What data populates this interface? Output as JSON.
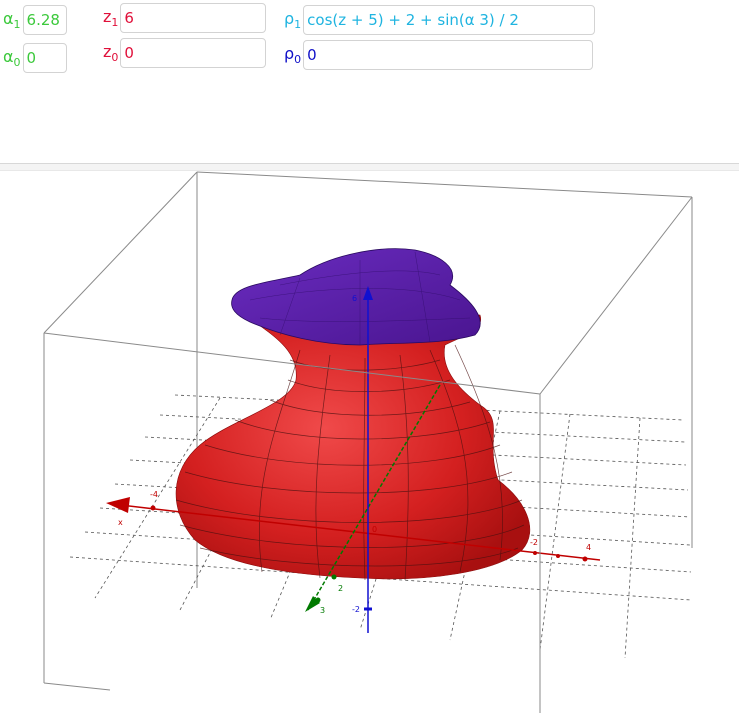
{
  "params": {
    "alpha1": {
      "symbol": "α",
      "sub": "1",
      "value": "6.28"
    },
    "alpha0": {
      "symbol": "α",
      "sub": "0",
      "value": "0"
    },
    "z1": {
      "symbol": "z",
      "sub": "1",
      "value": "6"
    },
    "z0": {
      "symbol": "z",
      "sub": "0",
      "value": "0"
    },
    "rho1": {
      "symbol": "ρ",
      "sub": "1",
      "value": "cos(z + 5) + 2 + sin(α 3) / 2"
    },
    "rho0": {
      "symbol": "ρ",
      "sub": "0",
      "value": "0"
    }
  },
  "axes": {
    "x_label": "x",
    "z_label": "z",
    "x_ticks": [
      "-4",
      "-2",
      "2",
      "4"
    ],
    "y_ticks": [
      "-2",
      "2",
      "3"
    ],
    "z_ticks": [
      "-2",
      "6"
    ],
    "origin_label": "0"
  },
  "colors": {
    "alpha": "#3cc93c",
    "z": "#e0103a",
    "rho1": "#1fb4e0",
    "rho0": "#1010c8",
    "surface_side": "#d42020",
    "surface_top": "#5a1fa8",
    "x_axis": "#c00000",
    "y_axis": "#007a00",
    "z_axis": "#1010d0"
  }
}
